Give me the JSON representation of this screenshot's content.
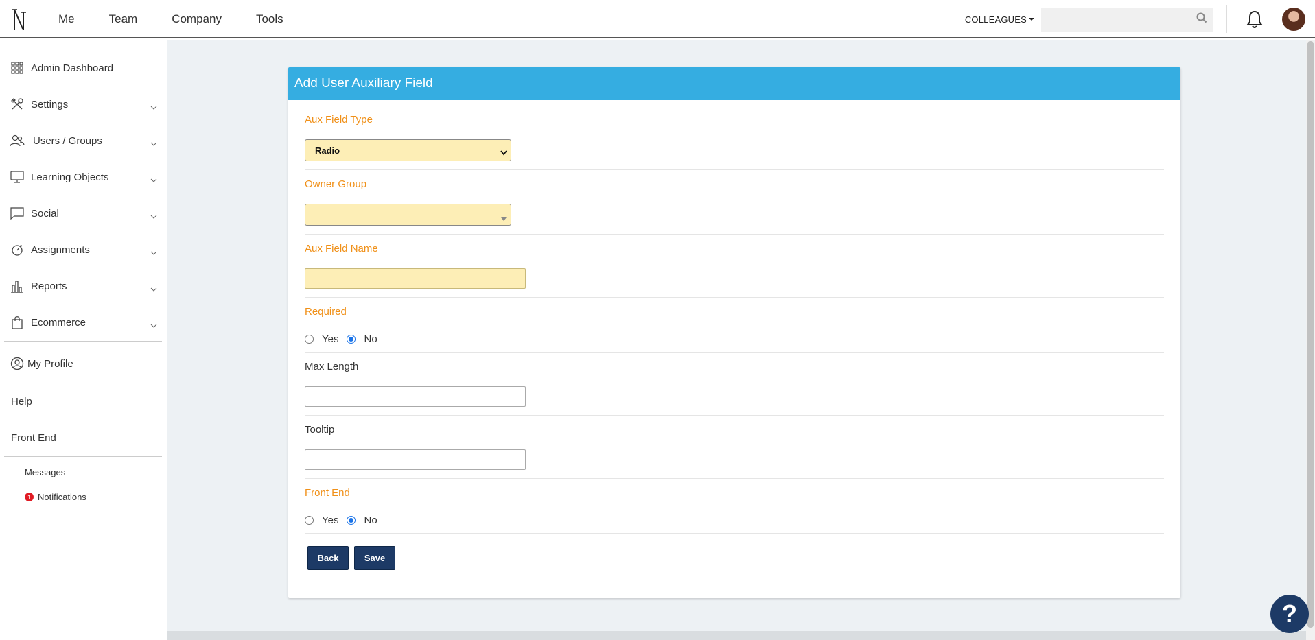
{
  "topnav": {
    "items": [
      "Me",
      "Team",
      "Company",
      "Tools"
    ],
    "colleagues_label": "COLLEAGUES",
    "search_placeholder": ""
  },
  "sidebar": {
    "items": [
      {
        "label": "Admin Dashboard",
        "icon": "grid-icon"
      },
      {
        "label": "Settings",
        "icon": "tools-icon"
      },
      {
        "label": "Users / Groups",
        "icon": "users-icon"
      },
      {
        "label": "Learning Objects",
        "icon": "monitor-icon"
      },
      {
        "label": "Social",
        "icon": "chat-icon"
      },
      {
        "label": "Assignments",
        "icon": "timer-icon"
      },
      {
        "label": "Reports",
        "icon": "bar-chart-icon"
      },
      {
        "label": "Ecommerce",
        "icon": "shopping-bag-icon"
      }
    ],
    "my_profile": "My Profile",
    "help": "Help",
    "front_end": "Front End",
    "messages": "Messages",
    "notifications": "Notifications",
    "notifications_count": "1"
  },
  "panel": {
    "title": "Add User Auxiliary Field"
  },
  "form": {
    "aux_field_type": {
      "label": "Aux Field Type",
      "value": "Radio"
    },
    "owner_group": {
      "label": "Owner Group",
      "value": ""
    },
    "aux_field_name": {
      "label": "Aux Field Name",
      "value": ""
    },
    "required": {
      "label": "Required",
      "yes": "Yes",
      "no": "No",
      "selected": "No"
    },
    "max_length": {
      "label": "Max Length",
      "value": ""
    },
    "tooltip": {
      "label": "Tooltip",
      "value": ""
    },
    "front_end": {
      "label": "Front End",
      "yes": "Yes",
      "no": "No",
      "selected": "No"
    },
    "back_label": "Back",
    "save_label": "Save"
  },
  "help_fab": "?",
  "colors": {
    "header": "#35ade1",
    "button": "#1d3a66",
    "required_label": "#f09018",
    "required_field": "#fdeeb6"
  }
}
